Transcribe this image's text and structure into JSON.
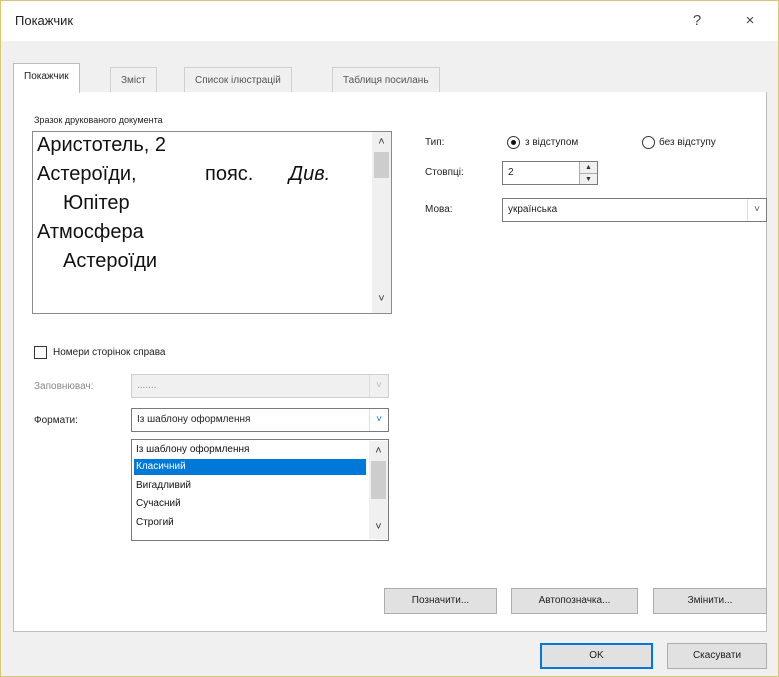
{
  "dialog": {
    "title": "Покажчик",
    "help_glyph": "?",
    "close_glyph": "×"
  },
  "tabs": [
    {
      "label": "Покажчик"
    },
    {
      "label": "Зміст"
    },
    {
      "label": "Список ілюстрацій"
    },
    {
      "label": "Таблиця посилань"
    }
  ],
  "preview": {
    "label": "Зразок друкованого документа",
    "lines": [
      "Аристотель, 2",
      "Астероїди,",
      "пояс.",
      "Див.",
      "Юпітер",
      "Атмосфера",
      "Астероїди"
    ]
  },
  "type": {
    "label": "Тип:",
    "option_indent": "з відступом",
    "option_noindent": "без відступу",
    "selected": "з відступом"
  },
  "columns": {
    "label": "Стовпці:",
    "value": "2"
  },
  "language": {
    "label": "Мова:",
    "value": "українська"
  },
  "page_numbers_right": {
    "label": "Номери сторінок справа",
    "checked": false
  },
  "filler": {
    "label": "Заповнювач:",
    "value": "......."
  },
  "formats": {
    "label": "Формати:",
    "value": "Із шаблону оформлення",
    "options": [
      {
        "label": "Із шаблону оформлення"
      },
      {
        "label": "Класичний"
      },
      {
        "label": "Вигадливий"
      },
      {
        "label": "Сучасний"
      },
      {
        "label": "Строгий"
      }
    ],
    "highlighted": "Класичний"
  },
  "action_buttons": {
    "mark": "Позначити...",
    "automark": "Автопозначка...",
    "modify": "Змінити..."
  },
  "footer": {
    "ok": "OK",
    "cancel": "Скасувати"
  },
  "colors": {
    "accent": "#0078d7",
    "selection": "#0078d7"
  }
}
